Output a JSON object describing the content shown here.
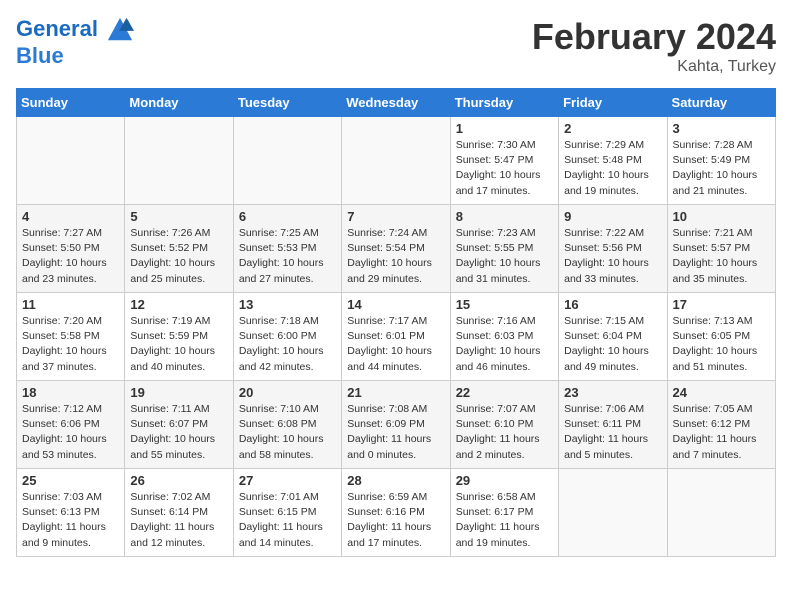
{
  "header": {
    "logo_line1": "General",
    "logo_line2": "Blue",
    "month": "February 2024",
    "location": "Kahta, Turkey"
  },
  "weekdays": [
    "Sunday",
    "Monday",
    "Tuesday",
    "Wednesday",
    "Thursday",
    "Friday",
    "Saturday"
  ],
  "weeks": [
    [
      {
        "day": "",
        "info": ""
      },
      {
        "day": "",
        "info": ""
      },
      {
        "day": "",
        "info": ""
      },
      {
        "day": "",
        "info": ""
      },
      {
        "day": "1",
        "info": "Sunrise: 7:30 AM\nSunset: 5:47 PM\nDaylight: 10 hours\nand 17 minutes."
      },
      {
        "day": "2",
        "info": "Sunrise: 7:29 AM\nSunset: 5:48 PM\nDaylight: 10 hours\nand 19 minutes."
      },
      {
        "day": "3",
        "info": "Sunrise: 7:28 AM\nSunset: 5:49 PM\nDaylight: 10 hours\nand 21 minutes."
      }
    ],
    [
      {
        "day": "4",
        "info": "Sunrise: 7:27 AM\nSunset: 5:50 PM\nDaylight: 10 hours\nand 23 minutes."
      },
      {
        "day": "5",
        "info": "Sunrise: 7:26 AM\nSunset: 5:52 PM\nDaylight: 10 hours\nand 25 minutes."
      },
      {
        "day": "6",
        "info": "Sunrise: 7:25 AM\nSunset: 5:53 PM\nDaylight: 10 hours\nand 27 minutes."
      },
      {
        "day": "7",
        "info": "Sunrise: 7:24 AM\nSunset: 5:54 PM\nDaylight: 10 hours\nand 29 minutes."
      },
      {
        "day": "8",
        "info": "Sunrise: 7:23 AM\nSunset: 5:55 PM\nDaylight: 10 hours\nand 31 minutes."
      },
      {
        "day": "9",
        "info": "Sunrise: 7:22 AM\nSunset: 5:56 PM\nDaylight: 10 hours\nand 33 minutes."
      },
      {
        "day": "10",
        "info": "Sunrise: 7:21 AM\nSunset: 5:57 PM\nDaylight: 10 hours\nand 35 minutes."
      }
    ],
    [
      {
        "day": "11",
        "info": "Sunrise: 7:20 AM\nSunset: 5:58 PM\nDaylight: 10 hours\nand 37 minutes."
      },
      {
        "day": "12",
        "info": "Sunrise: 7:19 AM\nSunset: 5:59 PM\nDaylight: 10 hours\nand 40 minutes."
      },
      {
        "day": "13",
        "info": "Sunrise: 7:18 AM\nSunset: 6:00 PM\nDaylight: 10 hours\nand 42 minutes."
      },
      {
        "day": "14",
        "info": "Sunrise: 7:17 AM\nSunset: 6:01 PM\nDaylight: 10 hours\nand 44 minutes."
      },
      {
        "day": "15",
        "info": "Sunrise: 7:16 AM\nSunset: 6:03 PM\nDaylight: 10 hours\nand 46 minutes."
      },
      {
        "day": "16",
        "info": "Sunrise: 7:15 AM\nSunset: 6:04 PM\nDaylight: 10 hours\nand 49 minutes."
      },
      {
        "day": "17",
        "info": "Sunrise: 7:13 AM\nSunset: 6:05 PM\nDaylight: 10 hours\nand 51 minutes."
      }
    ],
    [
      {
        "day": "18",
        "info": "Sunrise: 7:12 AM\nSunset: 6:06 PM\nDaylight: 10 hours\nand 53 minutes."
      },
      {
        "day": "19",
        "info": "Sunrise: 7:11 AM\nSunset: 6:07 PM\nDaylight: 10 hours\nand 55 minutes."
      },
      {
        "day": "20",
        "info": "Sunrise: 7:10 AM\nSunset: 6:08 PM\nDaylight: 10 hours\nand 58 minutes."
      },
      {
        "day": "21",
        "info": "Sunrise: 7:08 AM\nSunset: 6:09 PM\nDaylight: 11 hours\nand 0 minutes."
      },
      {
        "day": "22",
        "info": "Sunrise: 7:07 AM\nSunset: 6:10 PM\nDaylight: 11 hours\nand 2 minutes."
      },
      {
        "day": "23",
        "info": "Sunrise: 7:06 AM\nSunset: 6:11 PM\nDaylight: 11 hours\nand 5 minutes."
      },
      {
        "day": "24",
        "info": "Sunrise: 7:05 AM\nSunset: 6:12 PM\nDaylight: 11 hours\nand 7 minutes."
      }
    ],
    [
      {
        "day": "25",
        "info": "Sunrise: 7:03 AM\nSunset: 6:13 PM\nDaylight: 11 hours\nand 9 minutes."
      },
      {
        "day": "26",
        "info": "Sunrise: 7:02 AM\nSunset: 6:14 PM\nDaylight: 11 hours\nand 12 minutes."
      },
      {
        "day": "27",
        "info": "Sunrise: 7:01 AM\nSunset: 6:15 PM\nDaylight: 11 hours\nand 14 minutes."
      },
      {
        "day": "28",
        "info": "Sunrise: 6:59 AM\nSunset: 6:16 PM\nDaylight: 11 hours\nand 17 minutes."
      },
      {
        "day": "29",
        "info": "Sunrise: 6:58 AM\nSunset: 6:17 PM\nDaylight: 11 hours\nand 19 minutes."
      },
      {
        "day": "",
        "info": ""
      },
      {
        "day": "",
        "info": ""
      }
    ]
  ]
}
